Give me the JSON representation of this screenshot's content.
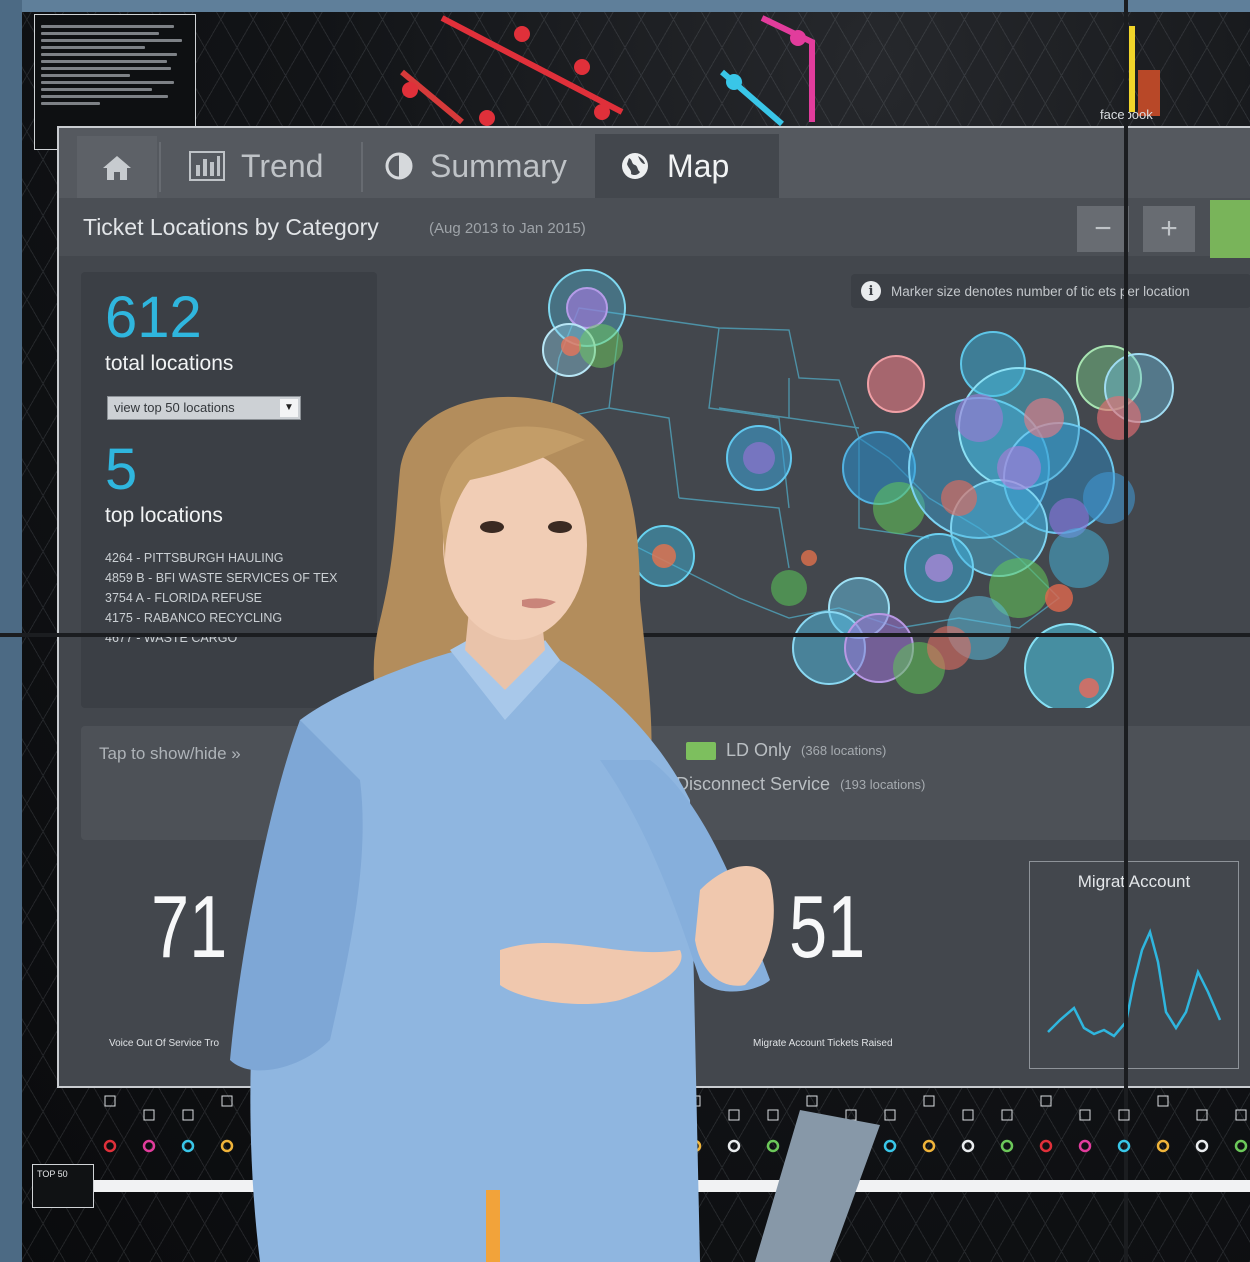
{
  "wall": {
    "brand_label": "facebook"
  },
  "tabs": {
    "home_icon": "home-icon",
    "trend": "Trend",
    "summary": "Summary",
    "map": "Map"
  },
  "header": {
    "title": "Ticket Locations by Category",
    "date_range": "(Aug 2013 to Jan 2015)",
    "zoom_out": "−",
    "zoom_in": "+"
  },
  "info_panel": {
    "total_count": "612",
    "total_label": "total locations",
    "select_value": "view top 50 locations",
    "top_count": "5",
    "top_label": "top locations",
    "locations": [
      "4264 - PITTSBURGH HAULING",
      "4859 B - BFI WASTE SERVICES OF TEX",
      "3754 A - FLORIDA REFUSE",
      "4175 - RABANCO RECYCLING",
      "4677 - WASTE CARGO"
    ]
  },
  "tooltip": {
    "text": "Marker size denotes number of tic  ets per location"
  },
  "legend": {
    "toggle": "Tap to show/hide »",
    "items": [
      {
        "label": "LD Only",
        "count": "(368 locations)"
      },
      {
        "label": "Disconnect Service",
        "count": "(193 locations)"
      }
    ]
  },
  "metrics": [
    {
      "value": "71",
      "label": "Voice Out Of Service Tro"
    },
    {
      "value": "51",
      "label": "Migrate Account Tickets Raised"
    }
  ],
  "spark": {
    "title": "Migrat  Account"
  },
  "bottom": {
    "badge": "TOP 50"
  },
  "colors": {
    "accent_blue": "#2fb6de",
    "legend_green": "#7dbf5e",
    "screen_bg": "#43474d"
  }
}
